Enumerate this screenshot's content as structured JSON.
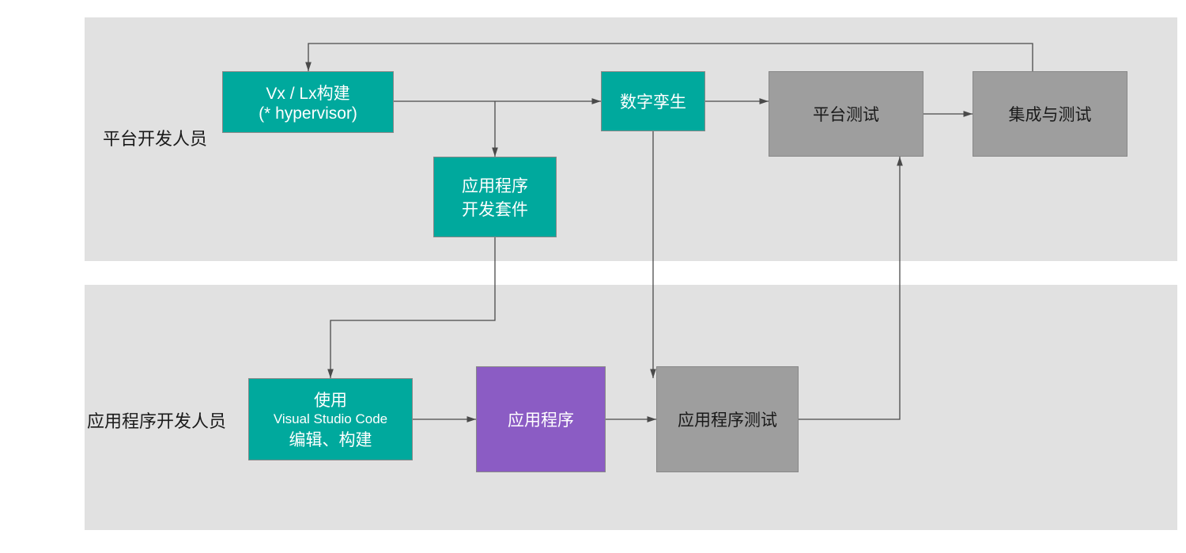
{
  "rows": {
    "platform_label": "平台开发人员",
    "app_label": "应用程序开发人员"
  },
  "boxes": {
    "vx_build": {
      "line1": "Vx / Lx构建",
      "line2": "(* hypervisor)"
    },
    "adk": {
      "line1": "应用程序",
      "line2": "开发套件"
    },
    "digital_twin": "数字孪生",
    "platform_test": "平台测试",
    "integration_test": "集成与测试",
    "vscode": {
      "line1": "使用",
      "line2": "Visual Studio Code",
      "line3": "编辑、构建"
    },
    "application": "应用程序",
    "app_test": "应用程序测试"
  },
  "colors": {
    "teal": "#00a99d",
    "gray": "#9e9e9e",
    "purple": "#8b5cc4",
    "panel": "#e1e1e1"
  }
}
